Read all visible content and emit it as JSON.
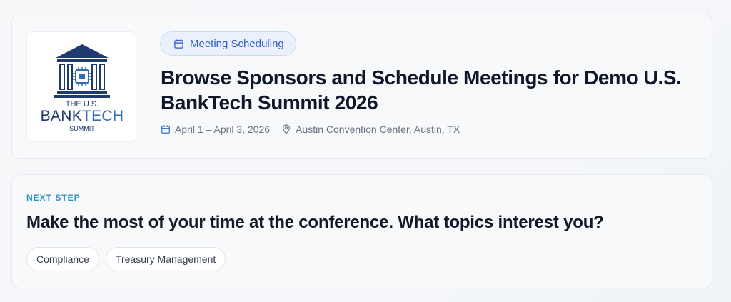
{
  "event": {
    "logo": {
      "line1": "THE U.S.",
      "line2_a": "BANK",
      "line2_b": "TECH",
      "line3": "SUMMIT"
    },
    "badge_label": "Meeting Scheduling",
    "title": "Browse Sponsors and Schedule Meetings for Demo U.S. BankTech Summit 2026",
    "dates": "April 1 – April 3, 2026",
    "location": "Austin Convention Center, Austin, TX"
  },
  "next_step": {
    "eyebrow": "NEXT STEP",
    "question": "Make the most of your time at the conference. What topics interest you?",
    "topics": [
      "Compliance",
      "Treasury Management"
    ]
  },
  "icons": {
    "badge": "calendar-icon",
    "dates": "calendar-icon",
    "location": "map-pin-icon"
  },
  "colors": {
    "accent_blue": "#2f5cc7",
    "eyebrow": "#2b8fc9",
    "logo_navy": "#1e3a6e"
  }
}
